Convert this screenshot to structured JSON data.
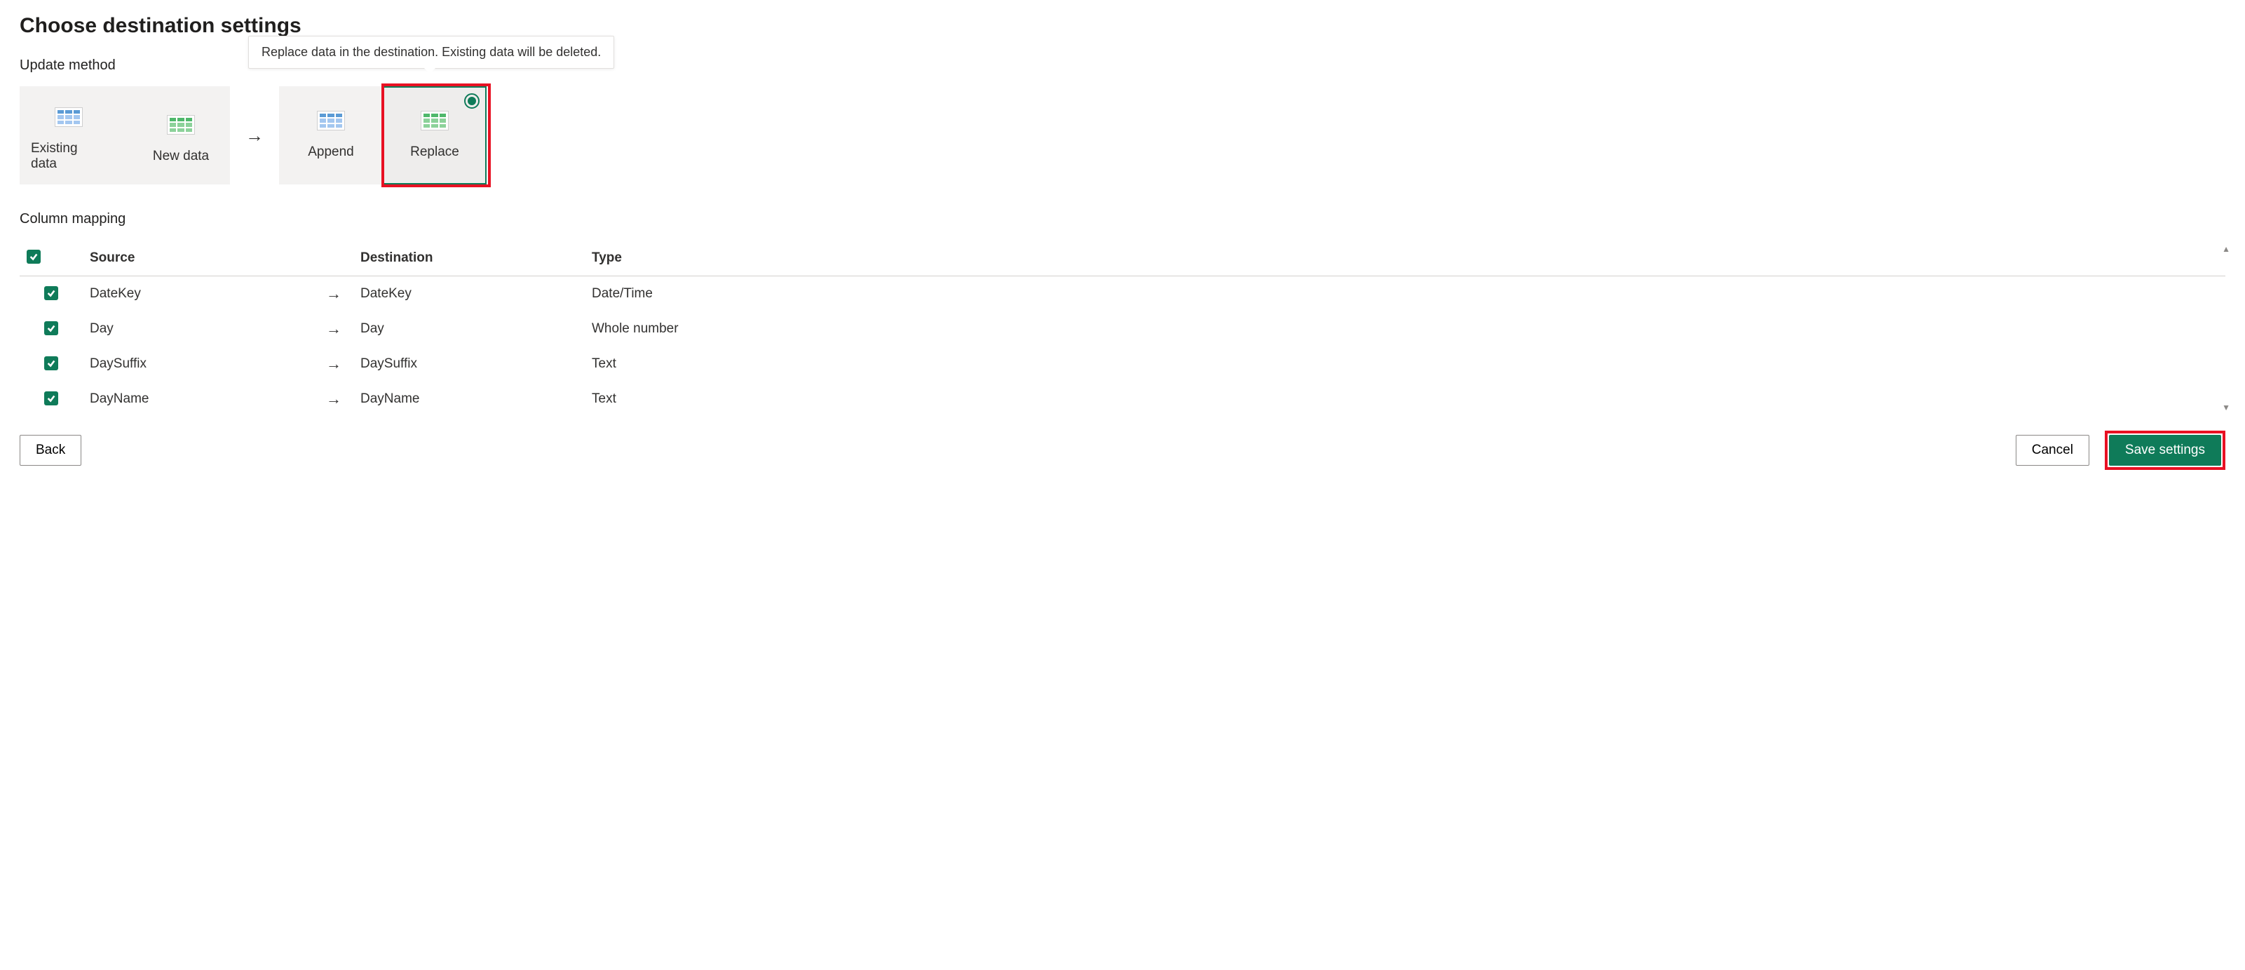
{
  "page_title": "Choose destination settings",
  "update_method": {
    "section_label": "Update method",
    "existing_data_label": "Existing data",
    "new_data_label": "New data",
    "append_label": "Append",
    "replace_label": "Replace",
    "tooltip": "Replace data in the destination. Existing data will be deleted."
  },
  "column_mapping": {
    "section_label": "Column mapping",
    "headers": {
      "source": "Source",
      "destination": "Destination",
      "type": "Type"
    },
    "rows": [
      {
        "source": "DateKey",
        "destination": "DateKey",
        "type": "Date/Time"
      },
      {
        "source": "Day",
        "destination": "Day",
        "type": "Whole number"
      },
      {
        "source": "DaySuffix",
        "destination": "DaySuffix",
        "type": "Text"
      },
      {
        "source": "DayName",
        "destination": "DayName",
        "type": "Text"
      }
    ]
  },
  "footer": {
    "back": "Back",
    "cancel": "Cancel",
    "save": "Save settings"
  }
}
